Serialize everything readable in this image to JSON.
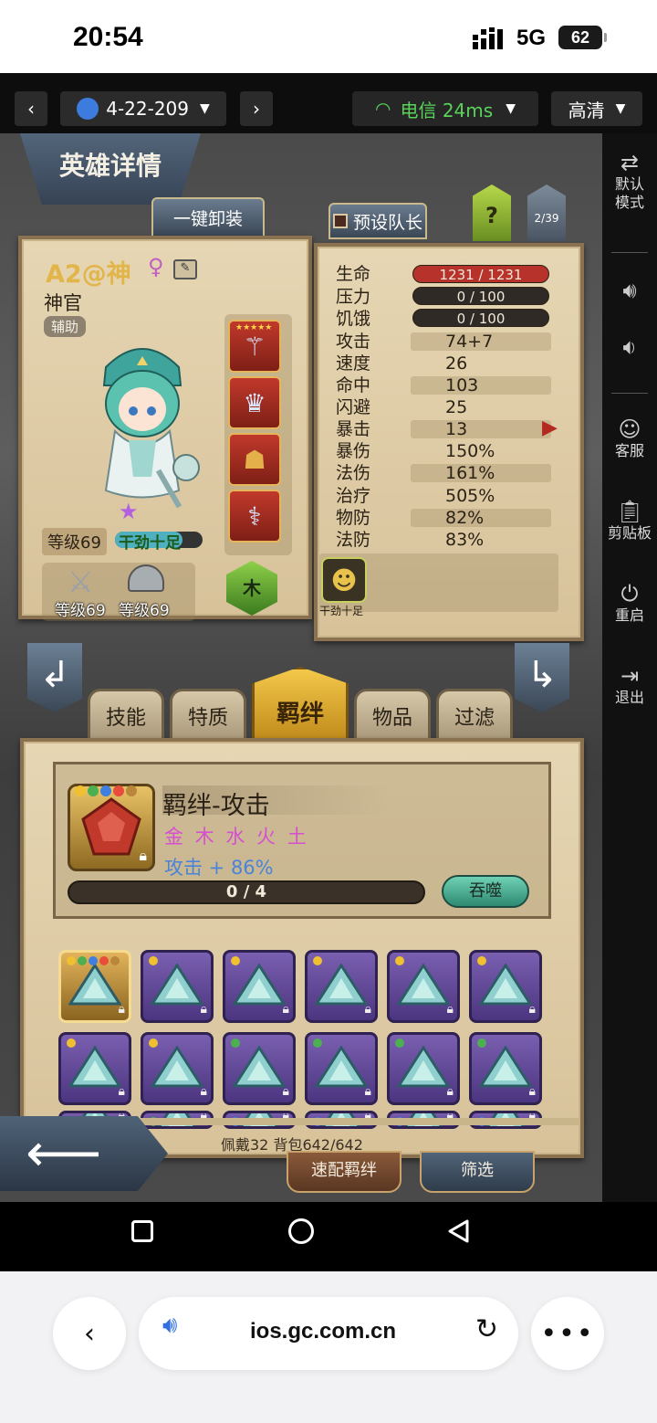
{
  "status_bar": {
    "time": "20:54",
    "network": "5G",
    "battery": "62"
  },
  "toolbar": {
    "device": "4-22-209",
    "network_label": "电信 24ms",
    "quality": "高清"
  },
  "game": {
    "screen_title": "英雄详情",
    "unequip_all": "一键卸装",
    "preset_captain": "预设队长",
    "help": "?",
    "page_counter": "2/39",
    "hero": {
      "name": "A2@神",
      "class": "神官",
      "role": "辅助",
      "level": "等级69",
      "trait": "干劲十足",
      "element": "木",
      "weapon_level": "等级69",
      "armor_level": "等级69"
    },
    "stats": [
      {
        "label": "生命",
        "value": "1231 / 1231",
        "kind": "bar-red"
      },
      {
        "label": "压力",
        "value": "0 / 100",
        "kind": "bar-dark"
      },
      {
        "label": "饥饿",
        "value": "0 / 100",
        "kind": "bar-dark"
      },
      {
        "label": "攻击",
        "value": "74+7"
      },
      {
        "label": "速度",
        "value": "26"
      },
      {
        "label": "命中",
        "value": "103"
      },
      {
        "label": "闪避",
        "value": "25"
      },
      {
        "label": "暴击",
        "value": "13"
      },
      {
        "label": "暴伤",
        "value": "150%"
      },
      {
        "label": "法伤",
        "value": "161%"
      },
      {
        "label": "治疗",
        "value": "505%"
      },
      {
        "label": "物防",
        "value": "82%"
      },
      {
        "label": "法防",
        "value": "83%"
      }
    ],
    "status_icon_label": "干劲十足",
    "tabs": [
      "技能",
      "特质",
      "羁绊",
      "物品",
      "过滤"
    ],
    "active_tab": "羁绊",
    "bond": {
      "title": "羁绊-攻击",
      "elements": "金 木 水 火 土",
      "bonus": "攻击 + 86%",
      "progress_text": "0 / 4",
      "progress": 0,
      "devour": "吞噬"
    },
    "gems_row1_dots": [
      "multi",
      "#f0c030",
      "#f0c030",
      "#f0c030",
      "#f0c030",
      "#f0c030"
    ],
    "gems_row2_dots": [
      "#f0c030",
      "#f0c030",
      "#4caf50",
      "#4caf50",
      "#4caf50",
      "#4caf50"
    ],
    "gems_row3_dots": [
      "#4caf50",
      "#4caf50",
      "#3f7fe0",
      "#3f7fe0",
      "#3f7fe0",
      "#3f7fe0"
    ],
    "footer_info": "佩戴32 背包642/642",
    "quick_bond": "速配羁绊",
    "filter": "筛选"
  },
  "side_panel": {
    "default_mode": "默认模式",
    "customer_service": "客服",
    "clipboard": "剪贴板",
    "restart": "重启",
    "exit": "退出"
  },
  "browser": {
    "url": "ios.gc.com.cn"
  }
}
